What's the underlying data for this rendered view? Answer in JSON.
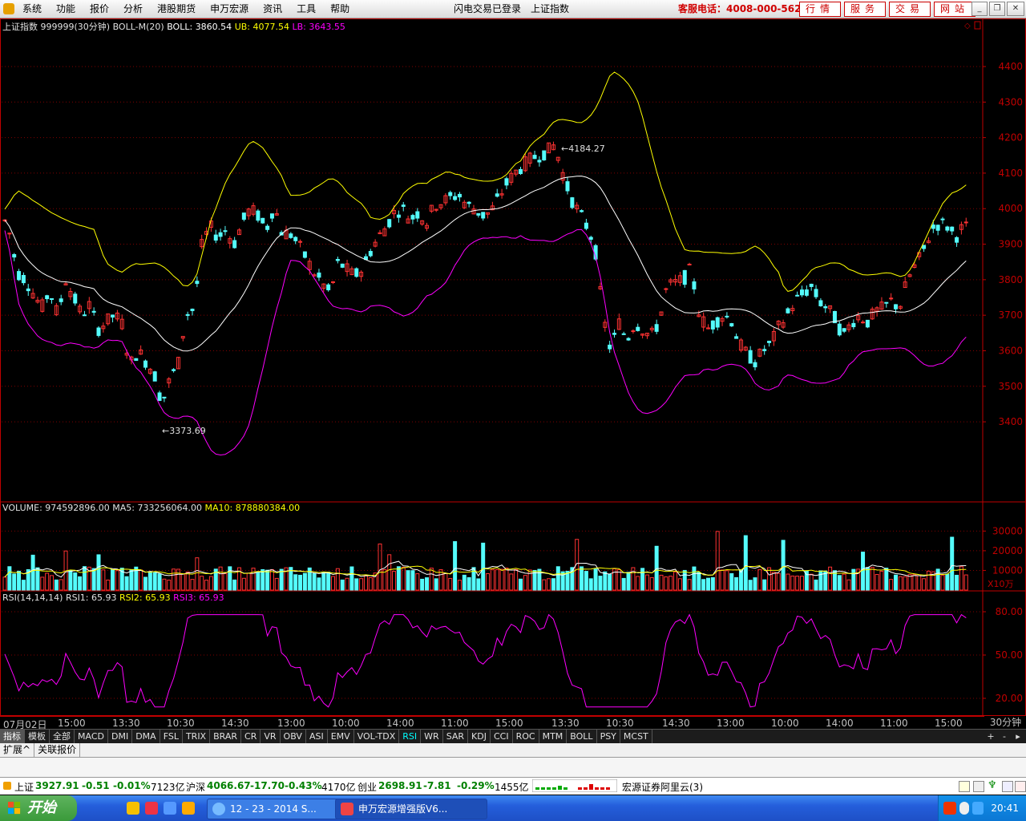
{
  "menu": {
    "items": [
      "系统",
      "功能",
      "报价",
      "分析",
      "港股期货",
      "申万宏源",
      "资讯",
      "工具",
      "帮助"
    ],
    "login_status": "闪电交易已登录",
    "current_index": "上证指数",
    "hotline": "客服电话：4008-000-562",
    "buttons": [
      "行情",
      "服务",
      "交易",
      "网站"
    ]
  },
  "main_chart": {
    "title": "上证指数",
    "code_period": "999999(30分钟)",
    "indicator": "BOLL-M(20)",
    "boll_label": "BOLL:",
    "boll_value": "3860.54",
    "ub_label": "UB:",
    "ub_value": "4077.54",
    "lb_label": "LB:",
    "lb_value": "3643.55",
    "high_label": "4184.27",
    "low_label": "3373.69",
    "y_ticks": [
      "4400",
      "4300",
      "4200",
      "4100",
      "4000",
      "3900",
      "3800",
      "3700",
      "3600",
      "3500",
      "3400"
    ]
  },
  "volume_chart": {
    "volume_label": "VOLUME:",
    "volume_value": "974592896.00",
    "ma5_label": "MA5:",
    "ma5_value": "733256064.00",
    "ma10_label": "MA10:",
    "ma10_value": "878880384.00",
    "y_ticks": [
      "30000",
      "20000",
      "10000"
    ],
    "unit": "X10万"
  },
  "rsi_chart": {
    "title": "RSI(14,14,14)",
    "rsi1_label": "RSI1:",
    "rsi1_value": "65.93",
    "rsi2_label": "RSI2:",
    "rsi2_value": "65.93",
    "rsi3_label": "RSI3:",
    "rsi3_value": "65.93",
    "y_ticks": [
      "80.00",
      "50.00",
      "20.00"
    ]
  },
  "time_axis": {
    "labels": [
      "07月02日",
      "15:00",
      "13:30",
      "10:30",
      "14:30",
      "13:00",
      "10:00",
      "14:00",
      "11:00",
      "15:00",
      "13:30",
      "10:30",
      "14:30",
      "13:00",
      "10:00",
      "14:00",
      "11:00",
      "15:00"
    ],
    "period": "30分钟"
  },
  "indicator_tabs": [
    "指标",
    "模板",
    "全部",
    "MACD",
    "DMI",
    "DMA",
    "FSL",
    "TRIX",
    "BRAR",
    "CR",
    "VR",
    "OBV",
    "ASI",
    "EMV",
    "VOL-TDX",
    "RSI",
    "WR",
    "SAR",
    "KDJ",
    "CCI",
    "ROC",
    "MTM",
    "BOLL",
    "PSY",
    "MCST"
  ],
  "bottom_tabs": [
    "扩展^",
    "关联报价"
  ],
  "ticker": {
    "sh_name": "上证",
    "sh_price": "3927.91",
    "sh_change": "-0.51",
    "sh_pct": "-0.01%",
    "sh_amount": "7123亿",
    "hs_name": "沪深",
    "hs_price": "4066.67",
    "hs_change": "-17.70",
    "hs_pct": "-0.43%",
    "hs_amount": "4170亿",
    "cy_name": "创业",
    "cy_price": "2698.91",
    "cy_change": "-7.81",
    "cy_pct": "-0.29%",
    "cy_amount": "1455亿",
    "server": "宏源证券阿里云(3)"
  },
  "taskbar": {
    "start": "开始",
    "items": [
      "12 - 23 - 2014 S...",
      "申万宏源增强版V6..."
    ],
    "clock": "20:41"
  },
  "colors": {
    "up": "#ff3232",
    "down": "#54fcfc",
    "boll": "#ffffff",
    "ub": "#ffff00",
    "lb": "#ff00ff",
    "grid": "#800000"
  }
}
